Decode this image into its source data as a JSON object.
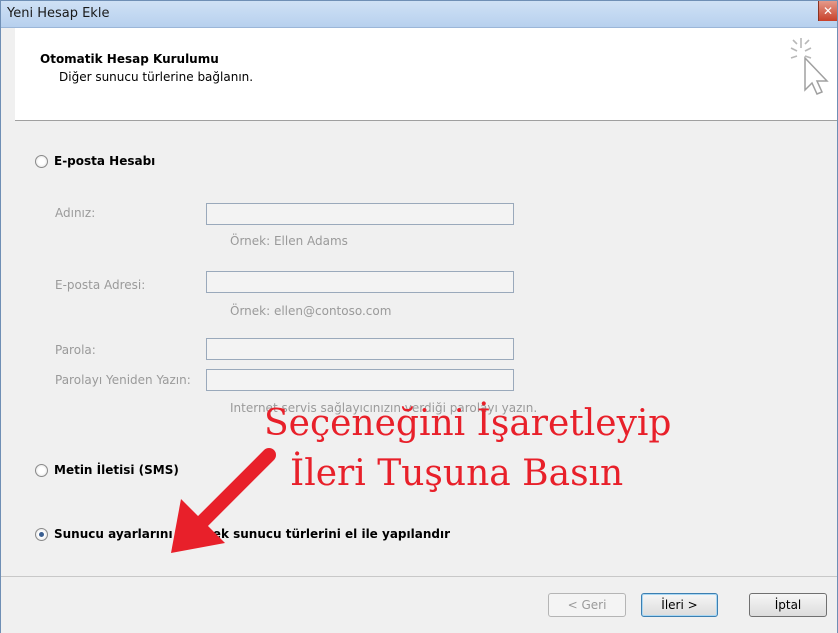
{
  "window": {
    "title": "Yeni Hesap Ekle",
    "close_glyph": "✕"
  },
  "header": {
    "title": "Otomatik Hesap Kurulumu",
    "subtitle": "Diğer sunucu türlerine bağlanın.",
    "icon": "wizard-cursor-icon"
  },
  "options": {
    "email_account": {
      "label": "E-posta Hesabı",
      "selected": false
    },
    "sms": {
      "label": "Metin İletisi (SMS)",
      "selected": false
    },
    "manual": {
      "label": "Sunucu ayarlarını veya ek sunucu türlerini el ile yapılandır",
      "selected": true
    }
  },
  "form": {
    "name_label": "Adınız:",
    "name_hint": "Örnek: Ellen Adams",
    "email_label": "E-posta Adresi:",
    "email_hint": "Örnek: ellen@contoso.com",
    "password_label": "Parola:",
    "password_confirm_label": "Parolayı Yeniden Yazın:",
    "password_hint": "Internet servis sağlayıcınızın verdiği parolayı yazın."
  },
  "overlay": {
    "line1": "Seçeneğini İşaretleyip",
    "line2": "İleri Tuşuna Basın",
    "color": "#e8202a"
  },
  "buttons": {
    "back": "< Geri",
    "next": "İleri >",
    "cancel": "İptal"
  }
}
